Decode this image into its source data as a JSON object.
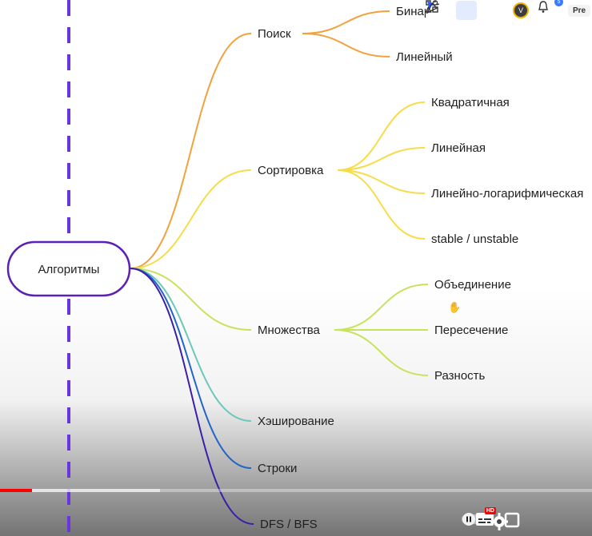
{
  "mindmap": {
    "root": "Алгоритмы",
    "branches": [
      {
        "label": "Поиск",
        "color": "#f2a23c",
        "children": [
          "Бинарный",
          "Линейный"
        ]
      },
      {
        "label": "Сортировка",
        "color": "#f7dc4a",
        "children": [
          "Квадратичная",
          "Линейная",
          "Линейно-логарифмическая",
          "stable / unstable"
        ]
      },
      {
        "label": "Множества",
        "color": "#c7e35c",
        "children": [
          "Объединение",
          "Пересечение",
          "Разность"
        ]
      },
      {
        "label": "Хэширование",
        "color": "#6cc8b8",
        "children": []
      },
      {
        "label": "Строки",
        "color": "#2165c9",
        "children": []
      },
      {
        "label": "DFS / BFS",
        "color": "#3b1fa8",
        "children": []
      }
    ],
    "root_border_color": "#5b21b6",
    "dashed_line_color": "#6a34e0"
  },
  "toolbar": {
    "icons": [
      "shapes-icon",
      "select-cursor-icon",
      "celebrate-icon",
      "user-avatar",
      "notification-bell-icon"
    ],
    "avatar_initial": "V",
    "bell_badge": "5",
    "present_label": "Pre"
  },
  "player": {
    "progress_played": 0.054,
    "progress_loaded": 0.27,
    "hd_badge": "HD",
    "accent": "#ff0000"
  }
}
